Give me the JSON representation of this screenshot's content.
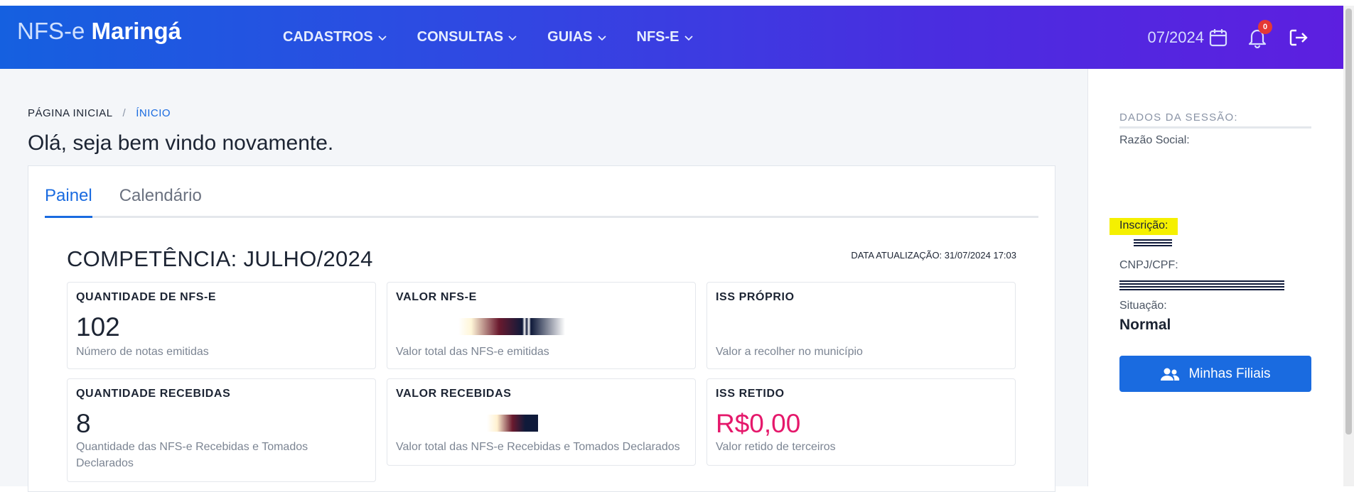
{
  "header": {
    "brand_light": "NFS-e",
    "brand_bold": "Maringá",
    "nav": [
      {
        "label": "CADASTROS"
      },
      {
        "label": "CONSULTAS"
      },
      {
        "label": "GUIAS"
      },
      {
        "label": "NFS-E"
      }
    ],
    "period": "07/2024",
    "notification_count": "0",
    "icons": {
      "calendar": "calendar-icon",
      "bell": "bell-icon",
      "logout": "logout-icon",
      "chevron": "chevron-down-icon"
    }
  },
  "breadcrumb": {
    "home": "PÁGINA INICIAL",
    "separator": "/",
    "current": "ÍNICIO"
  },
  "page_title": "Olá, seja bem vindo novamente.",
  "tabs": [
    {
      "label": "Painel",
      "active": true
    },
    {
      "label": "Calendário",
      "active": false
    }
  ],
  "dashboard": {
    "competencia": "COMPETÊNCIA: JULHO/2024",
    "data_atualizacao": "DATA ATUALIZAÇÃO: 31/07/2024 17:03",
    "cards": [
      {
        "label": "QUANTIDADE DE NFS-E",
        "value": "102",
        "desc": "Número de notas emitidas"
      },
      {
        "label": "VALOR NFS-E",
        "value": "",
        "desc": "Valor total das NFS-e emitidas"
      },
      {
        "label": "ISS PRÓPRIO",
        "value": "",
        "desc": "Valor a recolher no município"
      },
      {
        "label": "QUANTIDADE RECEBIDAS",
        "value": "8",
        "desc": "Quantidade das NFS-e Recebidas e Tomados Declarados"
      },
      {
        "label": "VALOR RECEBIDAS",
        "value": "",
        "desc": "Valor total das NFS-e Recebidas e Tomados Declarados"
      },
      {
        "label": "ISS RETIDO",
        "value": "R$0,00",
        "desc": "Valor retido de terceiros"
      }
    ]
  },
  "session": {
    "title": "DADOS DA SESSÃO:",
    "razao_social_label": "Razão Social:",
    "inscricao_label": "Inscrição:",
    "cnpj_label": "CNPJ/CPF:",
    "situacao_label": "Situação:",
    "situacao_value": "Normal",
    "filiais_button": "Minhas Filiais"
  },
  "colors": {
    "accent": "#1a6be0",
    "header_gradient_start": "#1560e0",
    "header_gradient_end": "#5d1fe0",
    "pink_value": "#e5186b",
    "highlight": "#f5f000"
  }
}
